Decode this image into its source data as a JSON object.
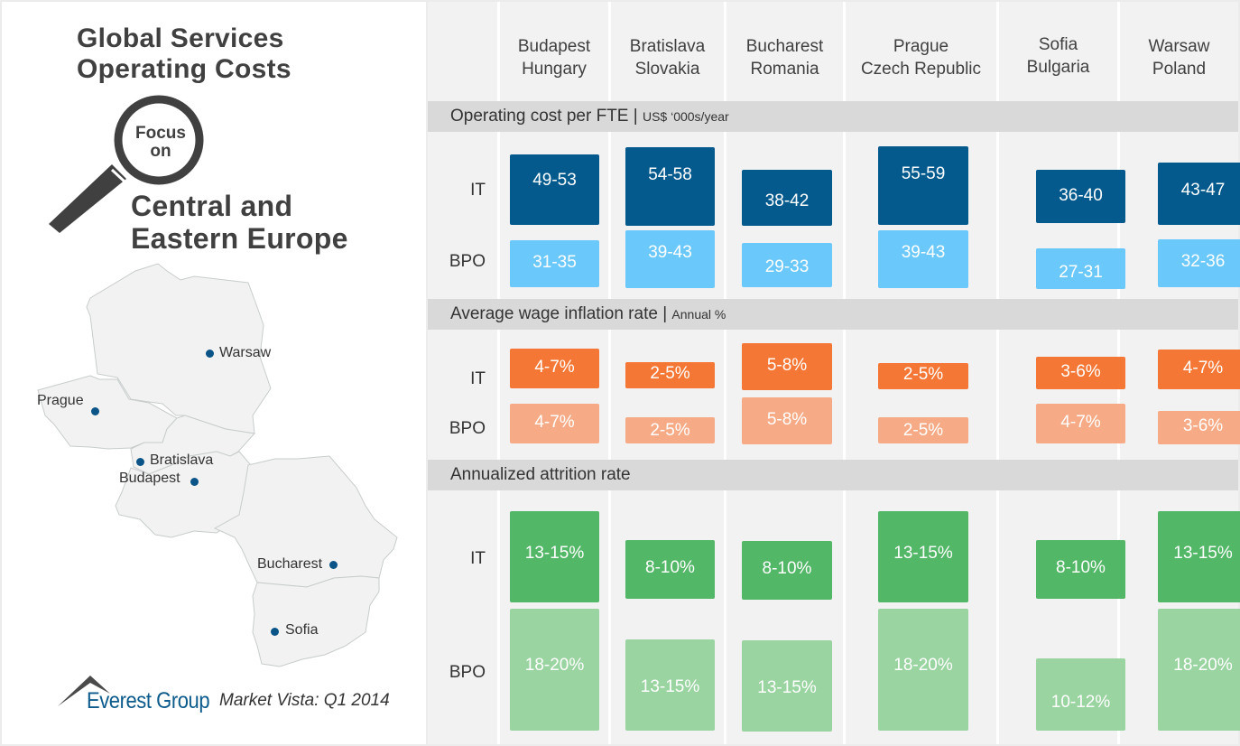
{
  "header": {
    "title_lines": [
      "Global Services",
      "Operating Costs"
    ],
    "focus_lines": [
      "Focus",
      "on"
    ],
    "region_lines": [
      "Central and",
      "Eastern Europe"
    ]
  },
  "map": {
    "cities": [
      {
        "name": "Warsaw"
      },
      {
        "name": "Prague"
      },
      {
        "name": "Bratislava"
      },
      {
        "name": "Budapest"
      },
      {
        "name": "Bucharest"
      },
      {
        "name": "Sofia"
      }
    ],
    "fill_color": "#f2f2f2",
    "dot_color": "#0a5488"
  },
  "footer": {
    "brand": "Everest Group",
    "publication": "Market Vista: Q1 2014"
  },
  "columns": [
    {
      "city": "Budapest",
      "country": "Hungary"
    },
    {
      "city": "Bratislava",
      "country": "Slovakia"
    },
    {
      "city": "Bucharest",
      "country": "Romania"
    },
    {
      "city": "Prague",
      "country": "Czech Republic"
    },
    {
      "city": "Sofia",
      "country": "Bulgaria"
    },
    {
      "city": "Warsaw",
      "country": "Poland"
    }
  ],
  "row_labels": {
    "it": "IT",
    "bpo": "BPO"
  },
  "sections": [
    {
      "title": "Operating cost per FTE | ",
      "unit": "US$ ‘000s/year",
      "colors": {
        "it": "#045a8d",
        "bpo": "#6bc8fb"
      },
      "it": [
        "49-53",
        "54-58",
        "38-42",
        "55-59",
        "36-40",
        "43-47"
      ],
      "bpo": [
        "31-35",
        "39-43",
        "29-33",
        "39-43",
        "27-31",
        "32-36"
      ]
    },
    {
      "title": "Average wage inflation rate | ",
      "unit": "Annual %",
      "colors": {
        "it": "#f47735",
        "bpo": "#f6ab86"
      },
      "it": [
        "4-7%",
        "2-5%",
        "5-8%",
        "2-5%",
        "3-6%",
        "4-7%"
      ],
      "bpo": [
        "4-7%",
        "2-5%",
        "5-8%",
        "2-5%",
        "4-7%",
        "3-6%"
      ]
    },
    {
      "title": "Annualized attrition rate",
      "unit": "",
      "colors": {
        "it": "#52b766",
        "bpo": "#9ad4a1"
      },
      "it": [
        "13-15%",
        "8-10%",
        "8-10%",
        "13-15%",
        "8-10%",
        "13-15%"
      ],
      "bpo": [
        "18-20%",
        "13-15%",
        "13-15%",
        "18-20%",
        "10-12%",
        "18-20%"
      ]
    }
  ]
}
